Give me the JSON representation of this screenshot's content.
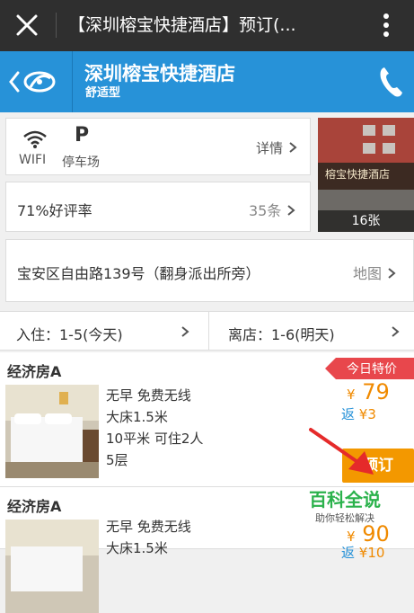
{
  "topbar": {
    "title": "【深圳榕宝快捷酒店】预订(..."
  },
  "header": {
    "hotel_name": "深圳榕宝快捷酒店",
    "hotel_type": "舒适型"
  },
  "amenities": {
    "wifi_label": "WIFI",
    "parking_icon": "P",
    "parking_label": "停车场",
    "details_label": "详情"
  },
  "rating": {
    "text": "71%好评率",
    "reviews": "35条"
  },
  "photo": {
    "count": "16张",
    "sign": "榕宝快捷酒店"
  },
  "address": {
    "text": "宝安区自由路139号（翻身派出所旁）",
    "map_label": "地图"
  },
  "dates": {
    "checkin": "入住：1-5(今天)",
    "checkout": "离店：1-6(明天)"
  },
  "promo": {
    "label": "今日特价"
  },
  "rooms": [
    {
      "name": "经济房A",
      "features": [
        "无早 免费无线",
        "大床1.5米",
        "10平米 可住2人",
        "5层"
      ],
      "currency": "¥",
      "price": "79",
      "cashback_prefix": "返",
      "cashback": "¥3",
      "book_label": "预订"
    },
    {
      "name": "经济房A",
      "features": [
        "无早 免费无线",
        "大床1.5米"
      ],
      "currency": "¥",
      "price": "90",
      "cashback_prefix": "返",
      "cashback": "¥10"
    }
  ],
  "watermark": {
    "title": "百科全说",
    "subtitle": "助你轻松解决"
  },
  "colors": {
    "topbar": "#2f2f2f",
    "header": "#2792d8",
    "accent": "#f39800",
    "promo": "#e8474c"
  }
}
